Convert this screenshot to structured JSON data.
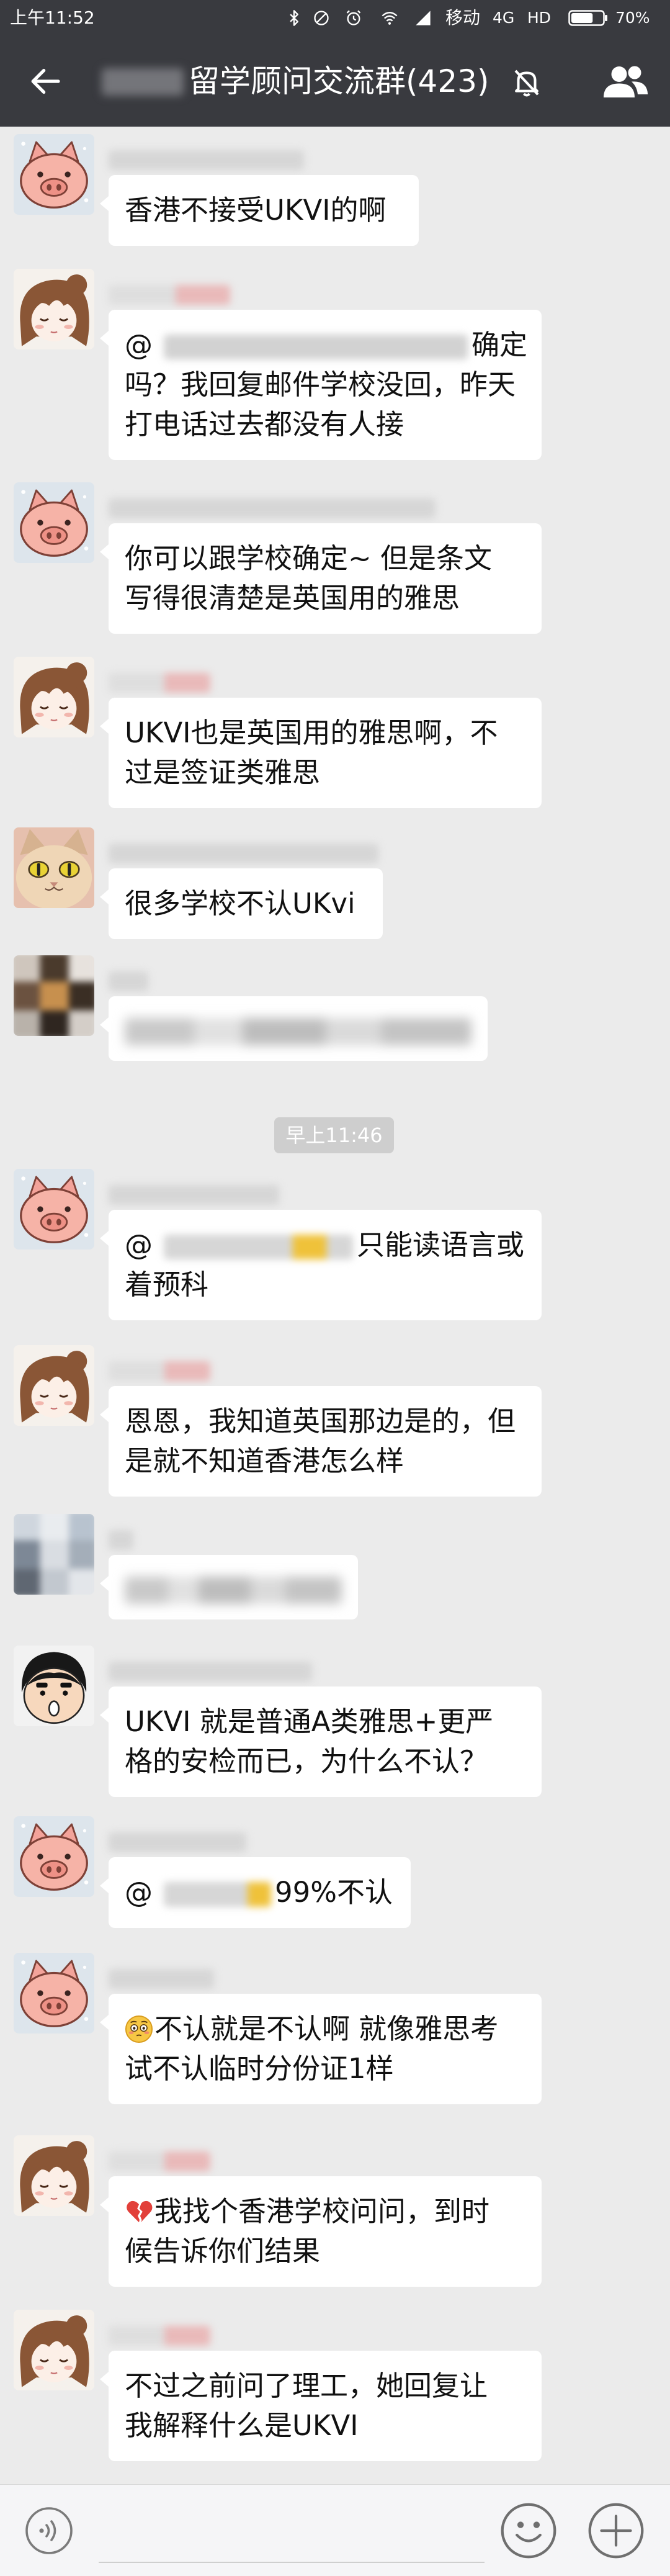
{
  "status_bar": {
    "time": "上午11:52",
    "carrier": "移动",
    "network": "4G",
    "hd": "HD",
    "battery": "70%",
    "battery_level": 0.7,
    "icons": [
      "bluetooth-icon",
      "do-not-disturb-icon",
      "alarm-icon",
      "wifi-icon",
      "signal-icon",
      "battery-icon"
    ]
  },
  "header": {
    "title": "留学顾问交流群(423)",
    "icons": [
      "back-arrow-icon",
      "mute-bell-icon",
      "group-members-icon"
    ]
  },
  "colors": {
    "header_bg": "#393a3f",
    "chat_bg": "#ebebeb",
    "bubble_bg": "#ffffff",
    "timestamp_bg": "#cecece",
    "input_bar_bg": "#f5f5f7"
  },
  "messages": [
    {
      "avatar": "pig-avatar",
      "lines": [
        "香港不接受UKVI的啊"
      ]
    },
    {
      "avatar": "girl-avatar",
      "mention": {
        "at": "@",
        "after": "确定"
      },
      "lines": [
        "吗？我回复邮件学校没回，昨天",
        "打电话过去都没有人接"
      ]
    },
    {
      "avatar": "pig-avatar",
      "lines": [
        "你可以跟学校确定~ 但是条文",
        "写得很清楚是英国用的雅思"
      ]
    },
    {
      "avatar": "girl-avatar",
      "lines": [
        "UKVI也是英国用的雅思啊，不",
        "过是签证类雅思"
      ]
    },
    {
      "avatar": "cat-avatar",
      "lines": [
        "很多学校不认UKvi"
      ]
    },
    {
      "avatar": "blurred-avatar"
    },
    {
      "avatar": "pig-avatar",
      "mention": {
        "at": "@",
        "after": "只能读语言或"
      },
      "lines": [
        "着预科"
      ]
    },
    {
      "avatar": "girl-avatar",
      "lines": [
        "恩恩，我知道英国那边是的，但",
        "是就不知道香港怎么样"
      ]
    },
    {
      "avatar": "blurred-avatar"
    },
    {
      "avatar": "cartoon-boy-avatar",
      "lines": [
        "UKVI 就是普通A类雅思+更严",
        "格的安检而已，为什么不认？"
      ]
    },
    {
      "avatar": "pig-avatar",
      "mention": {
        "at": "@",
        "after": "99%不认"
      }
    },
    {
      "avatar": "pig-avatar",
      "emoji": "flushed-face-icon",
      "lines": [
        "不认就是不认啊 就像雅思考",
        "试不认临时分份证1样"
      ]
    },
    {
      "avatar": "girl-avatar",
      "emoji": "broken-heart-icon",
      "lines": [
        "我找个香港学校问问，到时",
        "候告诉你们结果"
      ]
    },
    {
      "avatar": "girl-avatar",
      "lines": [
        "不过之前问了理工，她回复让",
        "我解释什么是UKVI"
      ]
    }
  ],
  "timestamp": "早上11:46",
  "input_bar": {
    "icons": [
      "voice-icon",
      "emoji-icon",
      "plus-icon"
    ]
  }
}
